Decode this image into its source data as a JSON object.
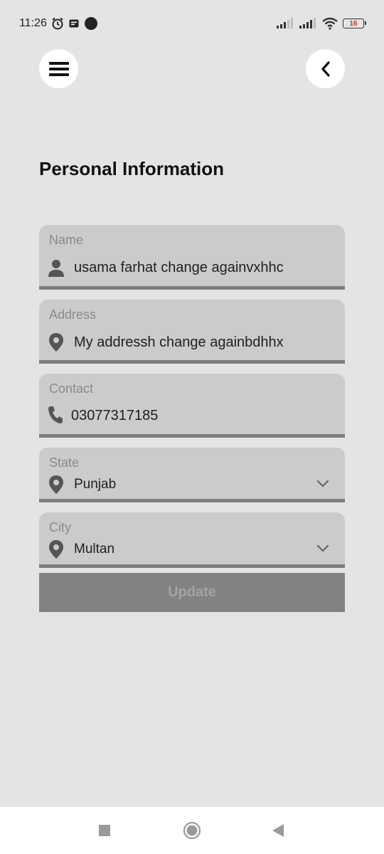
{
  "status_bar": {
    "time": "11:26",
    "battery": "16"
  },
  "page": {
    "title": "Personal Information"
  },
  "form": {
    "name": {
      "label": "Name",
      "value": "usama farhat change againvxhhc"
    },
    "address": {
      "label": "Address",
      "value": "My addressh change againbdhhx"
    },
    "contact": {
      "label": "Contact",
      "value": "03077317185"
    },
    "state": {
      "label": "State",
      "value": "Punjab"
    },
    "city": {
      "label": "City",
      "value": "Multan"
    },
    "update_label": "Update"
  },
  "icons": {
    "menu": "hamburger-icon",
    "back": "chevron-left-icon",
    "name": "person-icon",
    "address": "location-pin-icon",
    "contact": "phone-icon",
    "dropdown": "chevron-down-icon"
  },
  "colors": {
    "background": "#e4e4e4",
    "field": "#cbcbcb",
    "field_underline": "#7d7d7d",
    "button": "#828282",
    "button_text": "#a3a3a3",
    "battery_low": "#c0392b"
  }
}
